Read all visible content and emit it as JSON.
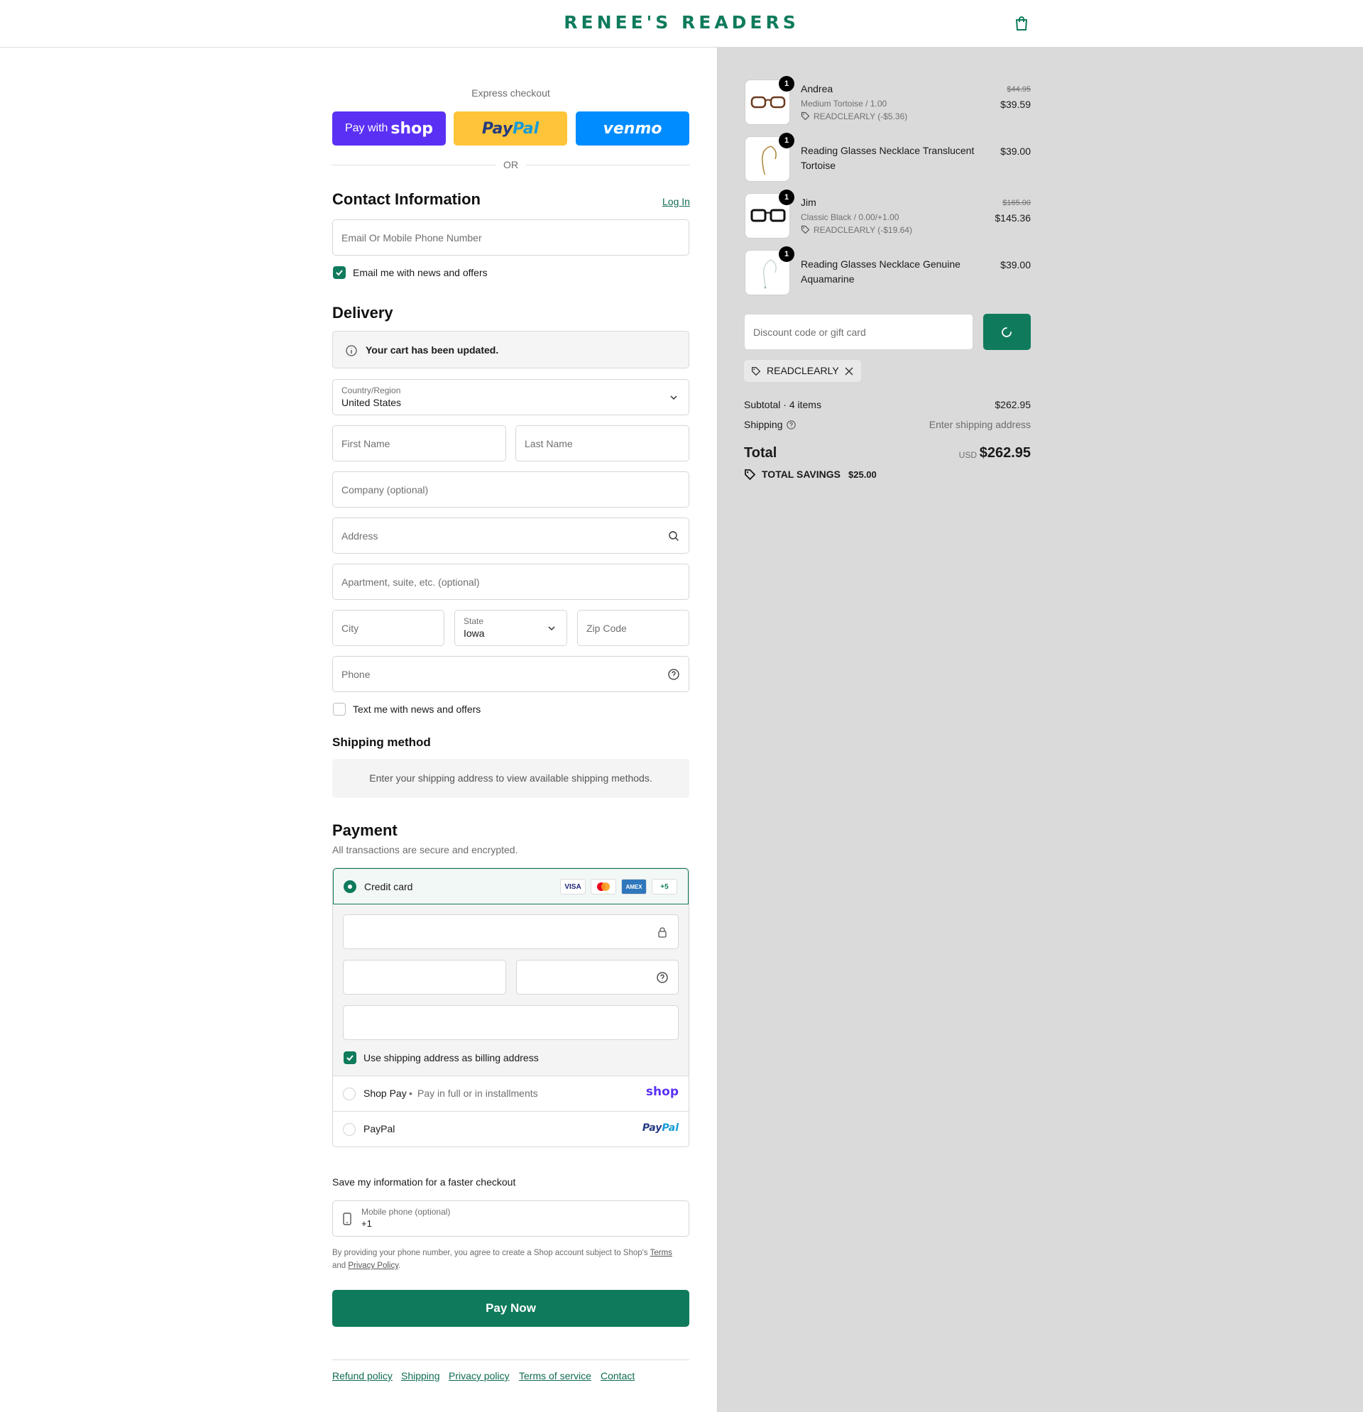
{
  "brand": {
    "name": "RENEE'S READERS",
    "accent": "#0f7b5c"
  },
  "express": {
    "label": "Express checkout",
    "shop_pay_prefix": "Pay with",
    "shop_pay_word": "shop",
    "paypal_a": "Pay",
    "paypal_b": "Pal",
    "venmo": "venmo",
    "or": "OR"
  },
  "contact": {
    "title": "Contact Information",
    "login": "Log In",
    "email_placeholder": "Email Or Mobile Phone Number",
    "news_label": "Email me with news and offers",
    "news_checked": true
  },
  "delivery": {
    "title": "Delivery",
    "notice": "Your cart has been updated.",
    "country_label": "Country/Region",
    "country_value": "United States",
    "first_name": "First Name",
    "last_name": "Last Name",
    "company": "Company (optional)",
    "address": "Address",
    "apartment": "Apartment, suite, etc. (optional)",
    "city": "City",
    "state_label": "State",
    "state_value": "Iowa",
    "zip": "Zip Code",
    "phone": "Phone",
    "text_label": "Text me with news and offers",
    "text_checked": false
  },
  "shipping_method": {
    "title": "Shipping method",
    "message": "Enter your shipping address to view available shipping methods."
  },
  "payment": {
    "title": "Payment",
    "subtitle": "All transactions are secure and encrypted.",
    "credit_card": "Credit card",
    "cards": [
      "VISA",
      "MC",
      "AMEX"
    ],
    "more_cards": "+5",
    "billing_label": "Use shipping address as billing address",
    "billing_checked": true,
    "shop_pay": "Shop Pay",
    "shop_pay_sub": "Pay in full or in installments",
    "shop_logo": "shop",
    "paypal": "PayPal",
    "paypal_logo_a": "Pay",
    "paypal_logo_b": "Pal"
  },
  "save_info": {
    "title": "Save my information for a faster checkout",
    "phone_label": "Mobile phone (optional)",
    "phone_value": "+1",
    "legal_1": "By providing your phone number, you agree to create a Shop account subject to Shop's",
    "terms": "Terms",
    "legal_2": "and",
    "privacy": "Privacy Policy",
    "legal_3": "."
  },
  "pay_now": "Pay Now",
  "footer_links": [
    "Refund policy",
    "Shipping",
    "Privacy policy",
    "Terms of service",
    "Contact"
  ],
  "cart": {
    "items": [
      {
        "qty": "1",
        "name": "Andrea",
        "variant": "Medium Tortoise / 1.00",
        "discount": "READCLEARLY (-$5.36)",
        "original": "$44.95",
        "price": "$39.59",
        "icon": "glasses-tortoise-icon"
      },
      {
        "qty": "1",
        "name_1": "Reading Glasses Necklace Translucent",
        "name_2": "Tortoise",
        "price": "$39.00",
        "icon": "necklace-icon"
      },
      {
        "qty": "1",
        "name": "Jim",
        "variant": "Classic Black / 0.00/+1.00",
        "discount": "READCLEARLY (-$19.64)",
        "original": "$165.00",
        "price": "$145.36",
        "icon": "glasses-black-icon"
      },
      {
        "qty": "1",
        "name_1": "Reading Glasses Necklace Genuine",
        "name_2": "Aquamarine",
        "price": "$39.00",
        "icon": "necklace-icon"
      }
    ],
    "discount_placeholder": "Discount code or gift card",
    "applied_code": "READCLEARLY",
    "subtotal_label": "Subtotal · 4 items",
    "subtotal": "$262.95",
    "shipping_label": "Shipping",
    "shipping_value": "Enter shipping address",
    "total_label": "Total",
    "currency": "USD",
    "total": "$262.95",
    "savings_label": "TOTAL SAVINGS",
    "savings": "$25.00"
  }
}
